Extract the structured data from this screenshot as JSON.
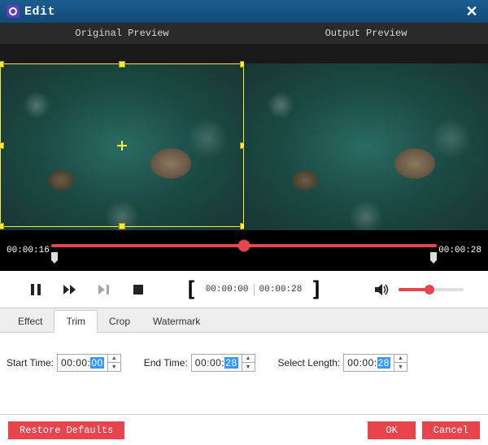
{
  "window": {
    "title": "Edit"
  },
  "preview": {
    "original_label": "Original Preview",
    "output_label": "Output Preview"
  },
  "timeline": {
    "current_time": "00:00:16",
    "end_time": "00:00:28"
  },
  "playback": {
    "range_start": "00:00:00",
    "range_end": "00:00:28"
  },
  "tabs": {
    "effect": "Effect",
    "trim": "Trim",
    "crop": "Crop",
    "watermark": "Watermark",
    "active": "trim"
  },
  "trim": {
    "start_label": "Start Time:",
    "start_prefix": "00:00:",
    "start_sel": "00",
    "end_label": "End Time:",
    "end_prefix": "00:00:",
    "end_sel": "28",
    "length_label": "Select Length:",
    "length_prefix": "00:00:",
    "length_sel": "28"
  },
  "buttons": {
    "restore": "Restore Defaults",
    "ok": "OK",
    "cancel": "Cancel"
  },
  "colors": {
    "accent": "#e8444e",
    "titlebar": "#0f4a7a",
    "crop": "#ffeb3b"
  }
}
